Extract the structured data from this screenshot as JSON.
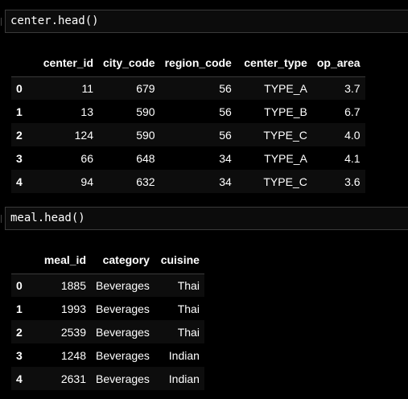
{
  "cells": [
    {
      "code": "center.head()",
      "table": {
        "columns": [
          "",
          "center_id",
          "city_code",
          "region_code",
          "center_type",
          "op_area"
        ],
        "rows": [
          [
            "0",
            "11",
            "679",
            "56",
            "TYPE_A",
            "3.7"
          ],
          [
            "1",
            "13",
            "590",
            "56",
            "TYPE_B",
            "6.7"
          ],
          [
            "2",
            "124",
            "590",
            "56",
            "TYPE_C",
            "4.0"
          ],
          [
            "3",
            "66",
            "648",
            "34",
            "TYPE_A",
            "4.1"
          ],
          [
            "4",
            "94",
            "632",
            "34",
            "TYPE_C",
            "3.6"
          ]
        ]
      }
    },
    {
      "code": "meal.head()",
      "table": {
        "columns": [
          "",
          "meal_id",
          "category",
          "cuisine"
        ],
        "rows": [
          [
            "0",
            "1885",
            "Beverages",
            "Thai"
          ],
          [
            "1",
            "1993",
            "Beverages",
            "Thai"
          ],
          [
            "2",
            "2539",
            "Beverages",
            "Thai"
          ],
          [
            "3",
            "1248",
            "Beverages",
            "Indian"
          ],
          [
            "4",
            "2631",
            "Beverages",
            "Indian"
          ]
        ]
      }
    }
  ],
  "colors": {
    "background": "#000000",
    "text": "#ffffff",
    "stripe": "#0d0d0d",
    "cell_border": "#3a3a3a"
  }
}
